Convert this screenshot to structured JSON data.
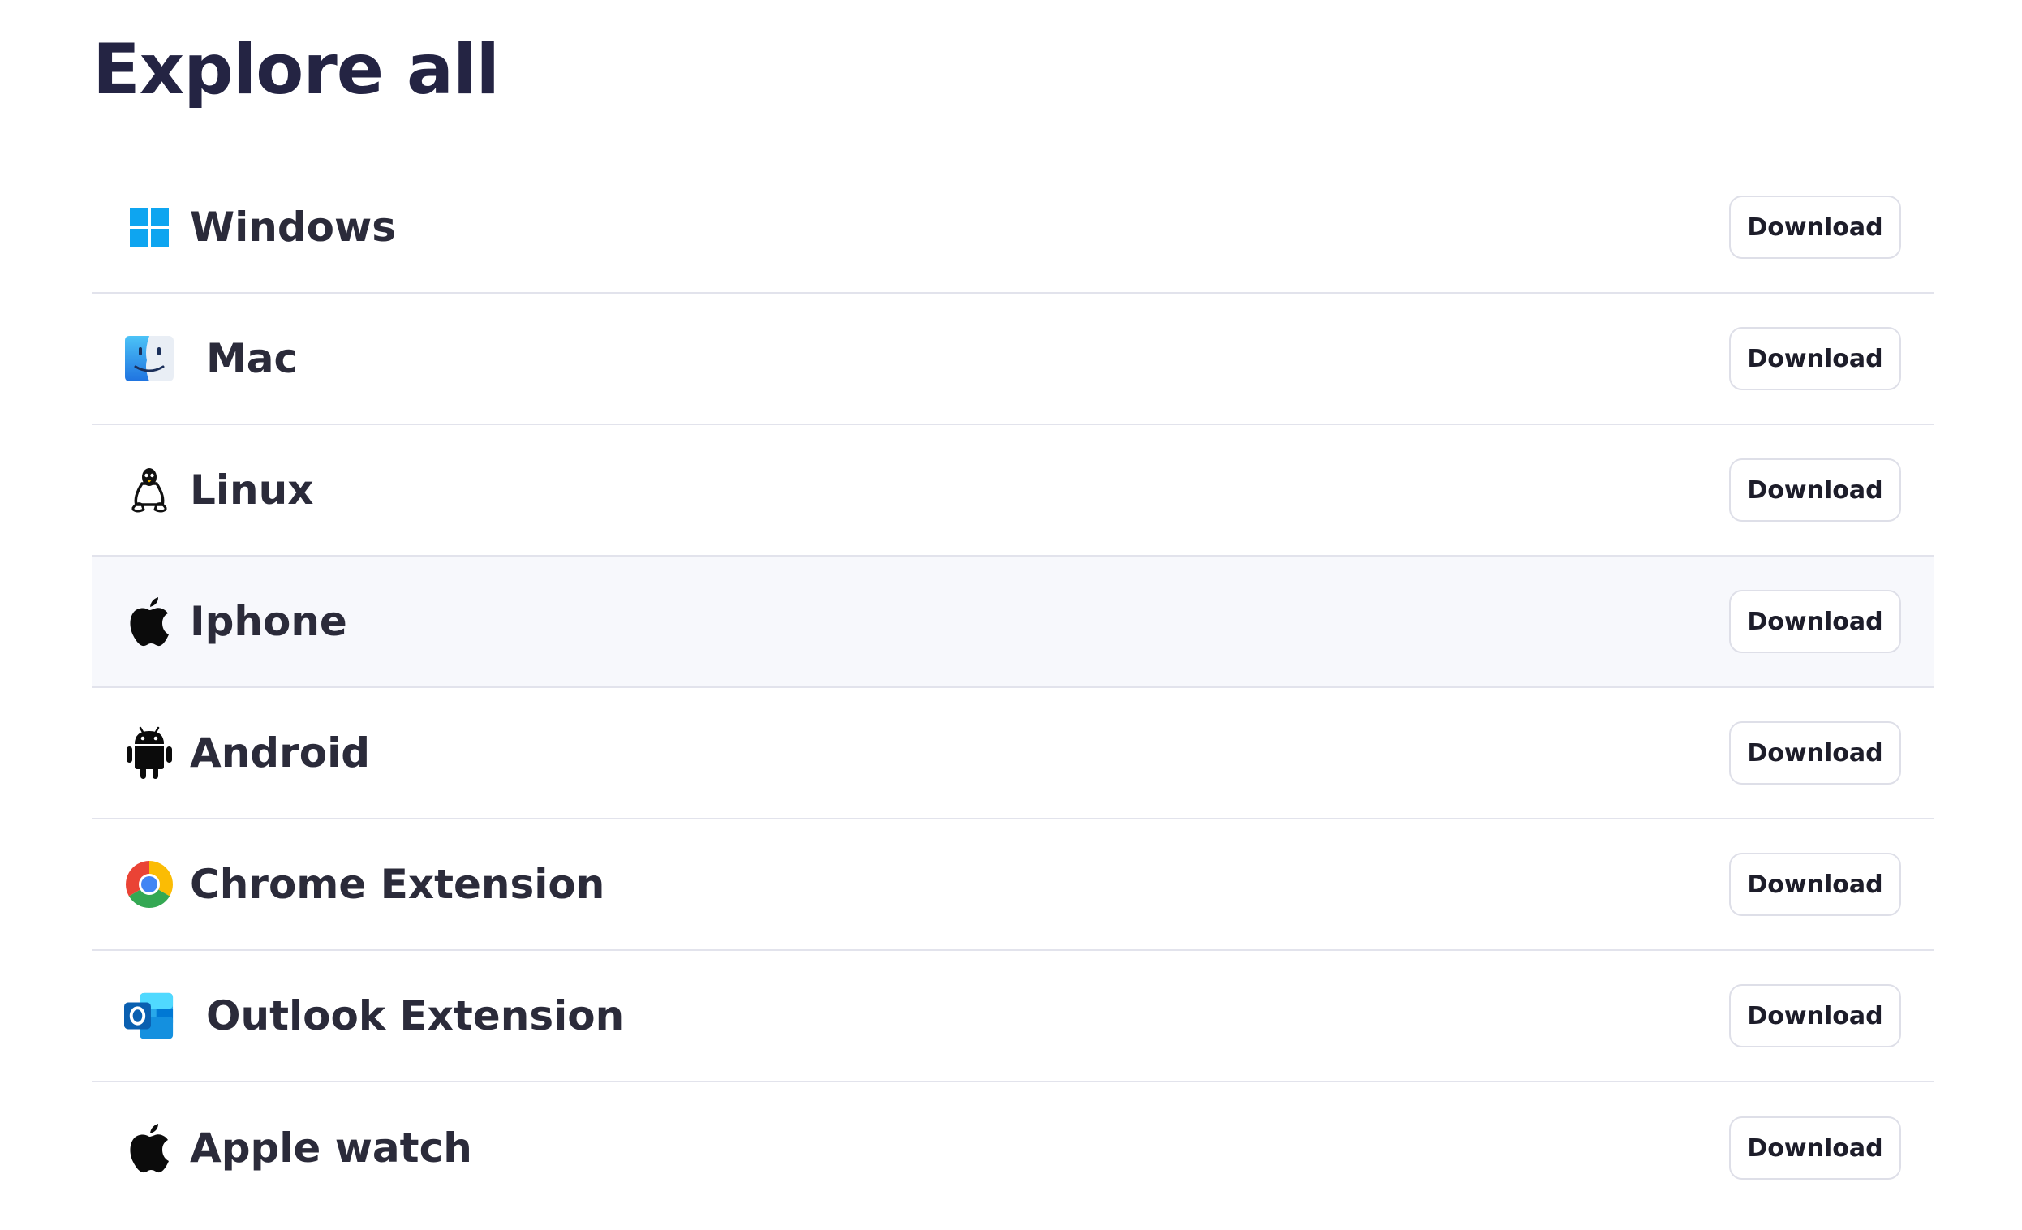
{
  "page": {
    "title": "Explore all"
  },
  "platforms": [
    {
      "label": "Windows",
      "icon": "windows-icon",
      "button_label": "Download"
    },
    {
      "label": "Mac",
      "icon": "mac-finder-icon",
      "button_label": "Download"
    },
    {
      "label": "Linux",
      "icon": "linux-penguin-icon",
      "button_label": "Download"
    },
    {
      "label": "Iphone",
      "icon": "apple-icon",
      "button_label": "Download"
    },
    {
      "label": "Android",
      "icon": "android-icon",
      "button_label": "Download"
    },
    {
      "label": "Chrome Extension",
      "icon": "chrome-icon",
      "button_label": "Download"
    },
    {
      "label": "Outlook Extension",
      "icon": "outlook-icon",
      "button_label": "Download"
    },
    {
      "label": "Apple watch",
      "icon": "apple-icon",
      "button_label": "Download"
    }
  ],
  "colors": {
    "title": "#242443",
    "label": "#2b2b3a",
    "divider": "#e2e3ec",
    "highlight_row": "#f7f8fc",
    "windows_blue": "#0ea5f0"
  }
}
